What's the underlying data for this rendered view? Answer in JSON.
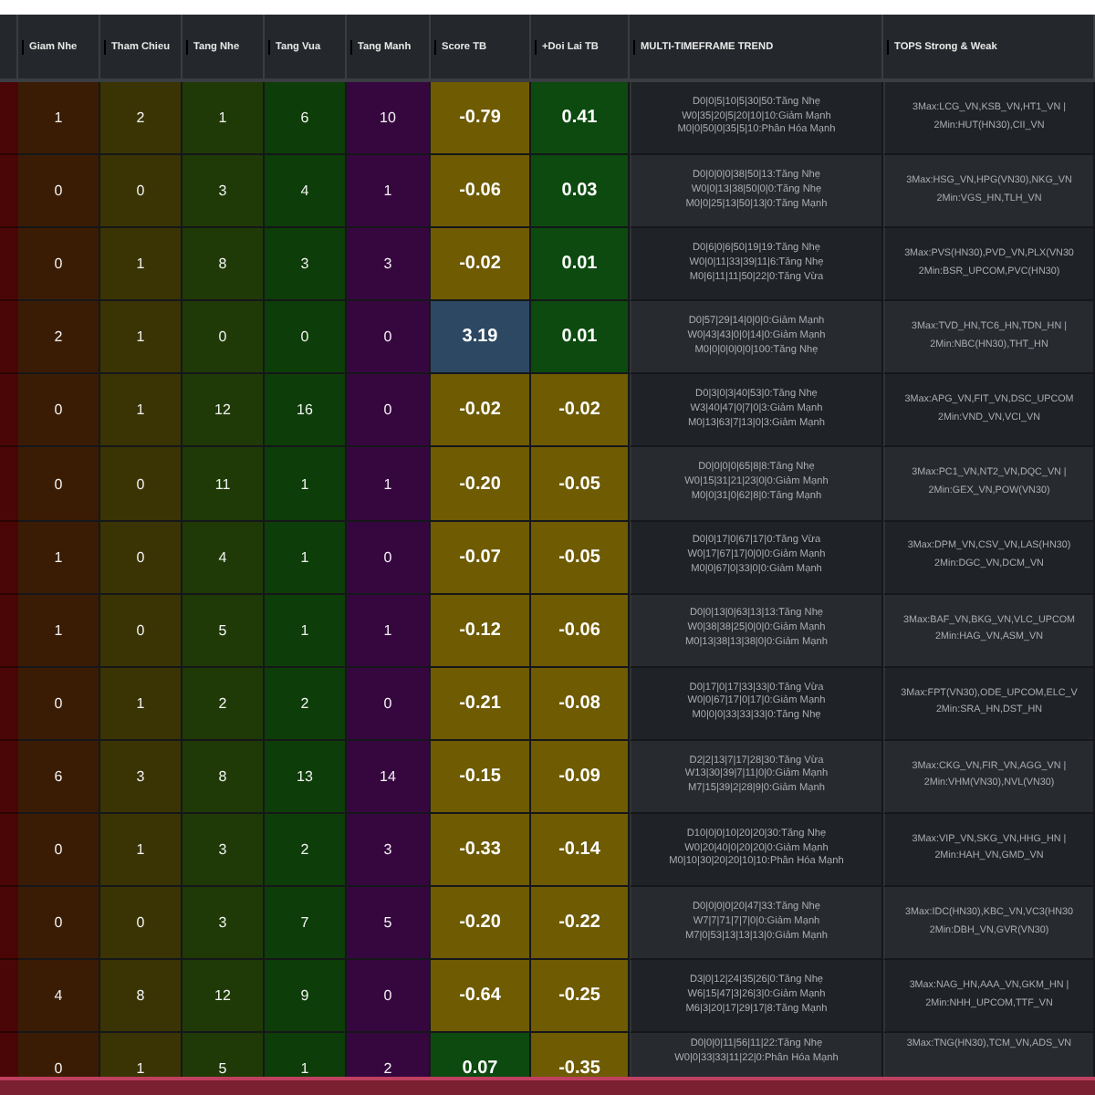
{
  "columns": [
    {
      "label": "Giam Nhe",
      "kind": "count",
      "color": "#3a1c04"
    },
    {
      "label": "Tham Chieu",
      "kind": "count",
      "color": "#3a3404"
    },
    {
      "label": "Tang Nhe",
      "kind": "count",
      "color": "#1f3a06"
    },
    {
      "label": "Tang Vua",
      "kind": "count",
      "color": "#0d3d08"
    },
    {
      "label": "Tang Manh",
      "kind": "count",
      "color": "#36073f"
    },
    {
      "label": "Score TB",
      "kind": "score"
    },
    {
      "label": "+Doi Lai TB",
      "kind": "rebound"
    },
    {
      "label": "MULTI-TIMEFRAME TREND",
      "kind": "trend"
    },
    {
      "label": "TOPS Strong & Weak",
      "kind": "tops"
    }
  ],
  "rows": [
    {
      "counts": [
        "1",
        "2",
        "1",
        "6",
        "10"
      ],
      "score": {
        "value": "-0.79",
        "color": "#6e5b02"
      },
      "rebound": {
        "value": "0.41",
        "color": "#0c4a0f"
      },
      "trend": [
        "D0|0|5|10|5|30|50:Tăng Nhẹ",
        "W0|35|20|5|20|10|10:Giảm Mạnh",
        "M0|0|50|0|35|5|10:Phân Hóa Mạnh"
      ],
      "tops": [
        "3Max:LCG_VN,KSB_VN,HT1_VN |",
        "2Min:HUT(HN30),CII_VN"
      ]
    },
    {
      "counts": [
        "0",
        "0",
        "3",
        "4",
        "1"
      ],
      "score": {
        "value": "-0.06",
        "color": "#6e5b02"
      },
      "rebound": {
        "value": "0.03",
        "color": "#0c4a0f"
      },
      "trend": [
        "D0|0|0|0|38|50|13:Tăng Nhẹ",
        "W0|0|13|38|50|0|0:Tăng Nhẹ",
        "M0|0|25|13|50|13|0:Tăng Mạnh"
      ],
      "tops": [
        "3Max:HSG_VN,HPG(VN30),NKG_VN",
        "2Min:VGS_HN,TLH_VN"
      ]
    },
    {
      "counts": [
        "0",
        "1",
        "8",
        "3",
        "3"
      ],
      "score": {
        "value": "-0.02",
        "color": "#6e5b02"
      },
      "rebound": {
        "value": "0.01",
        "color": "#0c4a0f"
      },
      "trend": [
        "D0|6|0|6|50|19|19:Tăng Nhẹ",
        "W0|0|11|33|39|11|6:Tăng Nhẹ",
        "M0|6|11|11|50|22|0:Tăng Vừa"
      ],
      "tops": [
        "3Max:PVS(HN30),PVD_VN,PLX(VN30",
        "2Min:BSR_UPCOM,PVC(HN30)"
      ]
    },
    {
      "counts": [
        "2",
        "1",
        "0",
        "0",
        "0"
      ],
      "score": {
        "value": "3.19",
        "color": "#2c4862"
      },
      "rebound": {
        "value": "0.01",
        "color": "#0c4a0f"
      },
      "trend": [
        "D0|57|29|14|0|0|0:Giảm Mạnh",
        "W0|43|43|0|0|14|0:Giảm Mạnh",
        "M0|0|0|0|0|0|100:Tăng Nhẹ"
      ],
      "tops": [
        "3Max:TVD_HN,TC6_HN,TDN_HN |",
        "2Min:NBC(HN30),THT_HN"
      ]
    },
    {
      "counts": [
        "0",
        "1",
        "12",
        "16",
        "0"
      ],
      "score": {
        "value": "-0.02",
        "color": "#6e5b02"
      },
      "rebound": {
        "value": "-0.02",
        "color": "#6e5b02"
      },
      "trend": [
        "D0|3|0|3|40|53|0:Tăng Nhẹ",
        "W3|40|47|0|7|0|3:Giảm Mạnh",
        "M0|13|63|7|13|0|3:Giảm Mạnh"
      ],
      "tops": [
        "3Max:APG_VN,FIT_VN,DSC_UPCOM",
        "2Min:VND_VN,VCI_VN"
      ]
    },
    {
      "counts": [
        "0",
        "0",
        "11",
        "1",
        "1"
      ],
      "score": {
        "value": "-0.20",
        "color": "#6e5b02"
      },
      "rebound": {
        "value": "-0.05",
        "color": "#6e5b02"
      },
      "trend": [
        "D0|0|0|0|65|8|8:Tăng Nhẹ",
        "W0|15|31|21|23|0|0:Giảm Mạnh",
        "M0|0|31|0|62|8|0:Tăng Mạnh"
      ],
      "tops": [
        "3Max:PC1_VN,NT2_VN,DQC_VN |",
        "2Min:GEX_VN,POW(VN30)"
      ]
    },
    {
      "counts": [
        "1",
        "0",
        "4",
        "1",
        "0"
      ],
      "score": {
        "value": "-0.07",
        "color": "#6e5b02"
      },
      "rebound": {
        "value": "-0.05",
        "color": "#6e5b02"
      },
      "trend": [
        "D0|0|17|0|67|17|0:Tăng Vừa",
        "W0|17|67|17|0|0|0:Giảm Mạnh",
        "M0|0|67|0|33|0|0:Giảm Mạnh"
      ],
      "tops": [
        "3Max:DPM_VN,CSV_VN,LAS(HN30)",
        "2Min:DGC_VN,DCM_VN"
      ]
    },
    {
      "counts": [
        "1",
        "0",
        "5",
        "1",
        "1"
      ],
      "score": {
        "value": "-0.12",
        "color": "#6e5b02"
      },
      "rebound": {
        "value": "-0.06",
        "color": "#6e5b02"
      },
      "trend": [
        "D0|0|13|0|63|13|13:Tăng Nhẹ",
        "W0|38|38|25|0|0|0:Giảm Mạnh",
        "M0|13|38|13|38|0|0:Giảm Mạnh"
      ],
      "tops": [
        "3Max:BAF_VN,BKG_VN,VLC_UPCOM",
        "2Min:HAG_VN,ASM_VN"
      ]
    },
    {
      "counts": [
        "0",
        "1",
        "2",
        "2",
        "0"
      ],
      "score": {
        "value": "-0.21",
        "color": "#6e5b02"
      },
      "rebound": {
        "value": "-0.08",
        "color": "#6e5b02"
      },
      "trend": [
        "D0|17|0|17|33|33|0:Tăng Vừa",
        "W0|0|67|17|0|17|0:Giảm Mạnh",
        "M0|0|0|33|33|33|0:Tăng Nhẹ"
      ],
      "tops": [
        "3Max:FPT(VN30),ODE_UPCOM,ELC_V",
        "2Min:SRA_HN,DST_HN"
      ]
    },
    {
      "counts": [
        "6",
        "3",
        "8",
        "13",
        "14"
      ],
      "score": {
        "value": "-0.15",
        "color": "#6e5b02"
      },
      "rebound": {
        "value": "-0.09",
        "color": "#6e5b02"
      },
      "trend": [
        "D2|2|13|7|17|28|30:Tăng Vừa",
        "W13|30|39|7|11|0|0:Giảm Mạnh",
        "M7|15|39|2|28|9|0:Giảm Mạnh"
      ],
      "tops": [
        "3Max:CKG_VN,FIR_VN,AGG_VN |",
        "2Min:VHM(VN30),NVL(VN30)"
      ]
    },
    {
      "counts": [
        "0",
        "1",
        "3",
        "2",
        "3"
      ],
      "score": {
        "value": "-0.33",
        "color": "#6e5b02"
      },
      "rebound": {
        "value": "-0.14",
        "color": "#6e5b02"
      },
      "trend": [
        "D10|0|0|10|20|20|30:Tăng Nhẹ",
        "W0|20|40|0|20|20|0:Giảm Mạnh",
        "M0|10|30|20|20|10|10:Phân Hóa Mạnh"
      ],
      "tops": [
        "3Max:VIP_VN,SKG_VN,HHG_HN |",
        "2Min:HAH_VN,GMD_VN"
      ]
    },
    {
      "counts": [
        "0",
        "0",
        "3",
        "7",
        "5"
      ],
      "score": {
        "value": "-0.20",
        "color": "#6e5b02"
      },
      "rebound": {
        "value": "-0.22",
        "color": "#6e5b02"
      },
      "trend": [
        "D0|0|0|0|20|47|33:Tăng Nhẹ",
        "W7|7|71|7|7|0|0:Giảm Mạnh",
        "M7|0|53|13|13|13|0:Giảm Mạnh"
      ],
      "tops": [
        "3Max:IDC(HN30),KBC_VN,VC3(HN30",
        "2Min:DBH_VN,GVR(VN30)"
      ]
    },
    {
      "counts": [
        "4",
        "8",
        "12",
        "9",
        "0"
      ],
      "score": {
        "value": "-0.64",
        "color": "#6e5b02"
      },
      "rebound": {
        "value": "-0.25",
        "color": "#6e5b02"
      },
      "trend": [
        "D3|0|12|24|35|26|0:Tăng Nhẹ",
        "W6|15|47|3|26|3|0:Giảm Mạnh",
        "M6|3|20|17|29|17|8:Tăng Mạnh"
      ],
      "tops": [
        "3Max:NAG_HN,AAA_VN,GKM_HN |",
        "2Min:NHH_UPCOM,TTF_VN"
      ]
    },
    {
      "counts": [
        "0",
        "1",
        "5",
        "1",
        "2"
      ],
      "score": {
        "value": "0.07",
        "color": "#0c4a0f"
      },
      "rebound": {
        "value": "-0.35",
        "color": "#6e5b02"
      },
      "trend": [
        "D0|0|0|11|56|11|22:Tăng Nhẹ",
        "W0|0|33|33|11|22|0:Phân Hóa Mạnh"
      ],
      "tops": [
        "3Max:TNG(HN30),TCM_VN,ADS_VN"
      ]
    }
  ]
}
